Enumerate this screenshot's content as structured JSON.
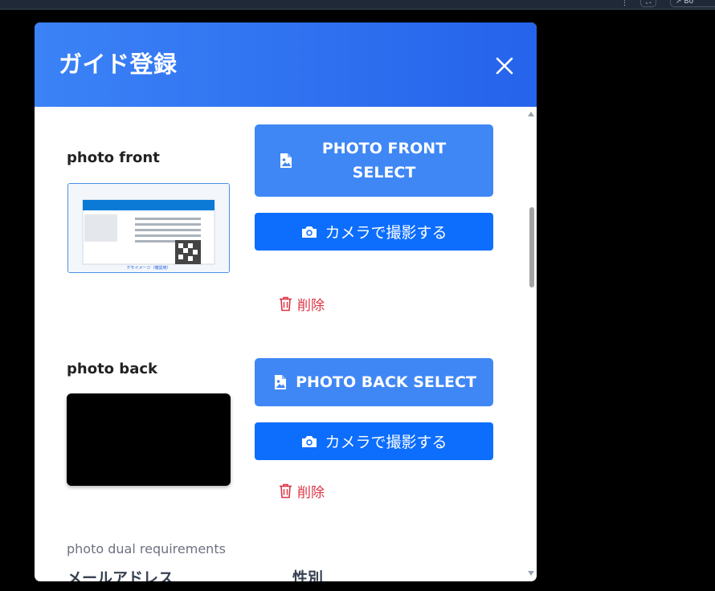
{
  "modal": {
    "title": "ガイド登録",
    "close_label": "×"
  },
  "photo_front": {
    "label": "photo front",
    "select_line1": "PHOTO FRONT",
    "select_line2": "SELECT",
    "camera_label": "カメラで撮影する",
    "delete_label": "削除",
    "demo_caption": "デモイメージ（確認用）"
  },
  "photo_back": {
    "label": "photo back",
    "select_label": "PHOTO BACK SELECT",
    "camera_label": "カメラで撮影する",
    "delete_label": "削除"
  },
  "requirements_text": "photo dual requirements",
  "fields": {
    "email_label": "メールアドレス",
    "gender_label": "性別"
  },
  "colors": {
    "header_start": "#3b82f6",
    "header_end": "#2563eb",
    "select_button": "#3f87f5",
    "camera_button": "#0d6efd",
    "delete": "#dc3545"
  }
}
